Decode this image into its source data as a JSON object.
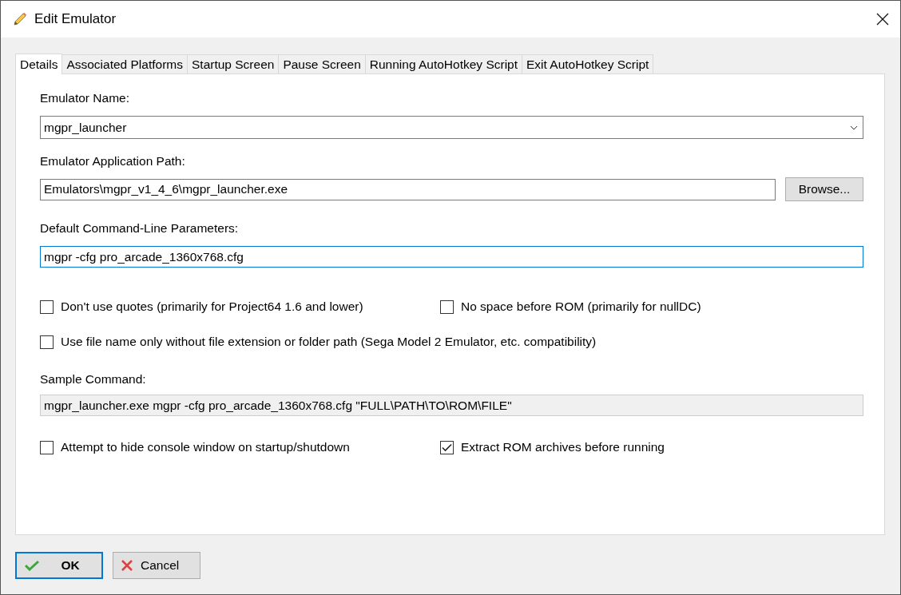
{
  "window": {
    "title": "Edit Emulator"
  },
  "tabs": [
    {
      "label": "Details",
      "selected": true
    },
    {
      "label": "Associated Platforms",
      "selected": false
    },
    {
      "label": "Startup Screen",
      "selected": false
    },
    {
      "label": "Pause Screen",
      "selected": false
    },
    {
      "label": "Running AutoHotkey Script",
      "selected": false
    },
    {
      "label": "Exit AutoHotkey Script",
      "selected": false
    }
  ],
  "emulator_name": {
    "label": "Emulator Name:",
    "value": "mgpr_launcher"
  },
  "application_path": {
    "label": "Emulator Application Path:",
    "value": "Emulators\\mgpr_v1_4_6\\mgpr_launcher.exe",
    "browse_button": "Browse..."
  },
  "command_line": {
    "label": "Default Command-Line Parameters:",
    "value": "mgpr -cfg pro_arcade_1360x768.cfg",
    "focused": true
  },
  "option_rows": [
    [
      {
        "label": "Don't use quotes (primarily for Project64 1.6 and lower)",
        "checked": false
      },
      {
        "label": "No space before ROM (primarily for nullDC)",
        "checked": false
      }
    ],
    [
      {
        "label": "Use file name only without file extension or folder path (Sega Model 2 Emulator, etc. compatibility)",
        "checked": false
      }
    ]
  ],
  "sample_command": {
    "label": "Sample Command:",
    "value": "mgpr_launcher.exe mgpr -cfg pro_arcade_1360x768.cfg \"FULL\\PATH\\TO\\ROM\\FILE\""
  },
  "bottom_options": [
    {
      "label": "Attempt to hide console window on startup/shutdown",
      "checked": false
    },
    {
      "label": "Extract ROM archives before running",
      "checked": true
    }
  ],
  "buttons": [
    {
      "kind": "ok",
      "label": "OK"
    },
    {
      "kind": "cancel",
      "label": "Cancel"
    }
  ]
}
